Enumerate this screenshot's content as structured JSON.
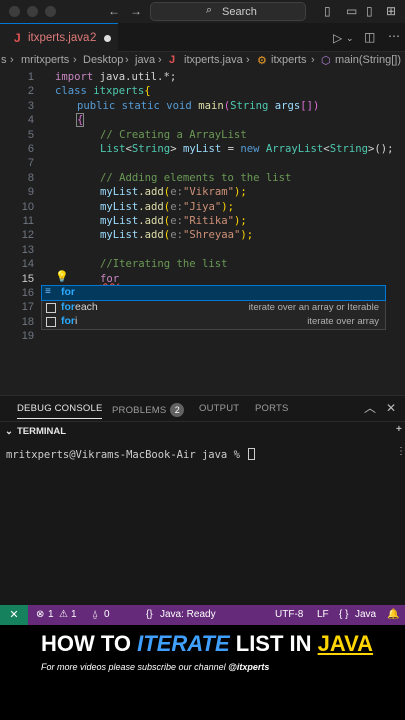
{
  "titlebar": {
    "search": "Search"
  },
  "tab": {
    "icon_letter": "J",
    "filename": "itxperts.java",
    "problems": "2"
  },
  "breadcrumb": {
    "items": [
      "s",
      "mritxperts",
      "Desktop",
      "java",
      "itxperts.java",
      "itxperts",
      "main(String[])"
    ]
  },
  "editor": {
    "line_numbers": [
      "1",
      "2",
      "3",
      "4",
      "5",
      "6",
      "7",
      "8",
      "9",
      "10",
      "11",
      "12",
      "13",
      "14",
      "15",
      "16",
      "17",
      "18",
      "19"
    ],
    "code": {
      "l1_kw": "import",
      "l1_rest": " java.util.*;",
      "l2_kw": "class",
      "l2_name": " itxperts",
      "l2_brace": "{",
      "l3_kw1": "public static void",
      "l3_fn": " main",
      "l3_p1": "(",
      "l3_ty": "String",
      "l3_var": " args",
      "l3_p2": "[])",
      "l4_brace": "{",
      "l5_cm": "// Creating a ArrayList",
      "l6_ty1": "List",
      "l6_lt": "<",
      "l6_ty2": "String",
      "l6_gt": ">",
      "l6_var": " myList",
      "l6_eq": " = ",
      "l6_new": "new",
      "l6_ty3": " ArrayList",
      "l6_g2": "<",
      "l6_ty4": "String",
      "l6_end": ">();",
      "l8_cm": "// Adding elements to the list",
      "add_obj": "myList",
      "add_fn": ".add",
      "add_open": "(",
      "add_hint": "e:",
      "add_close": ");",
      "names": [
        "\"Vikram\"",
        "\"Jiya\"",
        "\"Ritika\"",
        "\"Shreyaa\""
      ],
      "l14_cm": "//Iterating the list",
      "l15_kw": "for"
    },
    "suggestions": [
      {
        "match": "for",
        "rest": "",
        "description": ""
      },
      {
        "match": "for",
        "rest": "each",
        "description": "iterate over an array or Iterable"
      },
      {
        "match": "for",
        "rest": "i",
        "description": "iterate over array"
      }
    ]
  },
  "panel": {
    "tabs": [
      "DEBUG CONSOLE",
      "PROBLEMS",
      "OUTPUT",
      "PORTS"
    ],
    "problems_count": "2",
    "terminal_title": "TERMINAL",
    "prompt": "mritxperts@Vikrams-MacBook-Air java % "
  },
  "statusbar": {
    "remote": "✕",
    "errors": "1",
    "warnings": "1",
    "info": "0",
    "java_status": "Java: Ready",
    "encoding": "UTF-8",
    "eol": "LF",
    "language": "Java"
  },
  "banner": {
    "headline_pre": "HOW TO ",
    "headline_iterate": "ITERATE",
    "headline_mid": " LIST IN ",
    "headline_java": "JAVA",
    "sub_text": "For more videos please subscribe our channel ",
    "sub_handle": "@itxperts"
  },
  "colors": {
    "accent": "#0078d4",
    "statusbar": "#652a7a",
    "remote": "#16825d",
    "headline_blue": "#3fa0ff",
    "headline_yellow": "#ffd600"
  }
}
